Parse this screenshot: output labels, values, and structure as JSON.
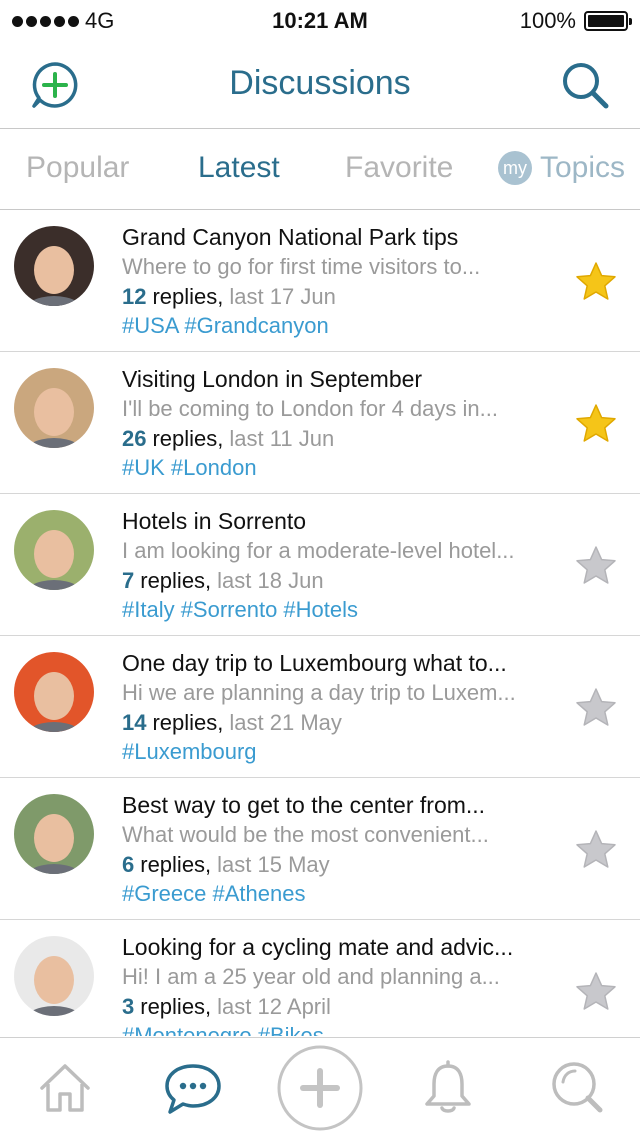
{
  "status_bar": {
    "carrier": "4G",
    "time": "10:21 AM",
    "battery": "100%"
  },
  "header": {
    "title": "Discussions",
    "left_icon": "add-bubble-icon",
    "right_icon": "search-icon"
  },
  "tabs": [
    {
      "label": "Popular",
      "active": false
    },
    {
      "label": "Latest",
      "active": true
    },
    {
      "label": "Favorite",
      "active": false
    },
    {
      "label": "Topics",
      "badge": "my",
      "active": false
    }
  ],
  "discussions": [
    {
      "title": "Grand Canyon National Park tips",
      "preview": "Where to go for first time visitors to...",
      "count": "12",
      "replies_word": "replies,",
      "date": "last 17 Jun",
      "tags": "#USA #Grandcanyon",
      "starred": true,
      "avatar_bg": "#3b2e2a"
    },
    {
      "title": "Visiting London in September",
      "preview": "I'll be coming to London for 4 days in...",
      "count": "26",
      "replies_word": "replies,",
      "date": "last 11 Jun",
      "tags": "#UK #London",
      "starred": true,
      "avatar_bg": "#caa77e"
    },
    {
      "title": "Hotels in Sorrento",
      "preview": "I am looking for a moderate-level hotel...",
      "count": "7",
      "replies_word": "replies,",
      "date": "last 18 Jun",
      "tags": "#Italy #Sorrento #Hotels",
      "starred": false,
      "avatar_bg": "#9bb06d"
    },
    {
      "title": "One day trip to Luxembourg what to...",
      "preview": "Hi we are planning a day trip to Luxem...",
      "count": "14",
      "replies_word": "replies,",
      "date": "last 21 May",
      "tags": "#Luxembourg",
      "starred": false,
      "avatar_bg": "#e2552a"
    },
    {
      "title": "Best way to get to the center from...",
      "preview": "What would be the most convenient...",
      "count": "6",
      "replies_word": "replies,",
      "date": "last 15 May",
      "tags": "#Greece #Athenes",
      "starred": false,
      "avatar_bg": "#7f9a6a"
    },
    {
      "title": "Looking for a cycling mate and advic...",
      "preview": "Hi! I am a 25 year old and planning a...",
      "count": "3",
      "replies_word": "replies,",
      "date": "last 12 April",
      "tags": "#Montenegro #Bikes",
      "starred": false,
      "avatar_bg": "#e9e9e9"
    }
  ],
  "tab_bar": [
    {
      "name": "home-icon",
      "active": false
    },
    {
      "name": "chat-bubble-icon",
      "active": true
    },
    {
      "name": "plus-icon",
      "active": false
    },
    {
      "name": "bell-icon",
      "active": false
    },
    {
      "name": "search-icon",
      "active": false
    }
  ],
  "colors": {
    "accent": "#2a6d8c",
    "tag": "#3a9bd0",
    "star_on": "#f5c518",
    "star_off": "#c8c8cc",
    "add_green": "#2bb34b"
  }
}
